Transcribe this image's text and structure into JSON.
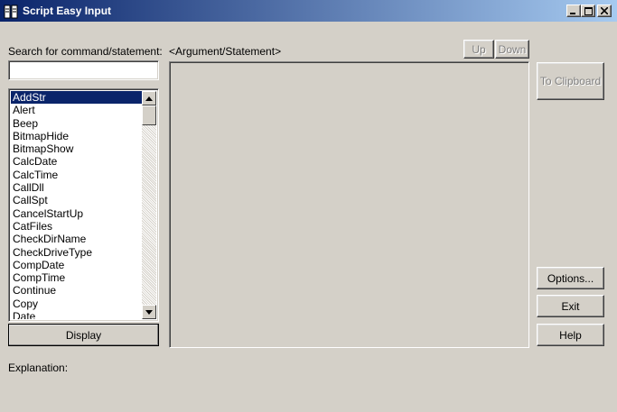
{
  "window": {
    "title": "Script Easy Input",
    "controls": [
      "minimize",
      "maximize",
      "close"
    ]
  },
  "search": {
    "label": "Search for command/statement:",
    "value": "",
    "placeholder": ""
  },
  "commands": {
    "selected_index": 0,
    "items": [
      "AddStr",
      "Alert",
      "Beep",
      "BitmapHide",
      "BitmapShow",
      "CalcDate",
      "CalcTime",
      "CallDll",
      "CallSpt",
      "CancelStartUp",
      "CatFiles",
      "CheckDirName",
      "CheckDriveType",
      "CompDate",
      "CompTime",
      "Continue",
      "Copy",
      "Date"
    ]
  },
  "argument_panel": {
    "label": "<Argument/Statement>",
    "up_label": "Up",
    "down_label": "Down"
  },
  "buttons": {
    "display": "Display",
    "to_clipboard": "To Clipboard",
    "options": "Options...",
    "exit": "Exit",
    "help": "Help"
  },
  "explanation": {
    "label": "Explanation:"
  },
  "icons": {
    "app": "app-icon",
    "minimize": "minimize-icon",
    "maximize": "maximize-icon",
    "close": "close-icon",
    "scroll_up": "arrow-up-icon",
    "scroll_down": "arrow-down-icon"
  },
  "colors": {
    "title_start": "#0a246a",
    "title_end": "#a6caf0",
    "face": "#d4d0c8",
    "selection": "#0a246a"
  }
}
